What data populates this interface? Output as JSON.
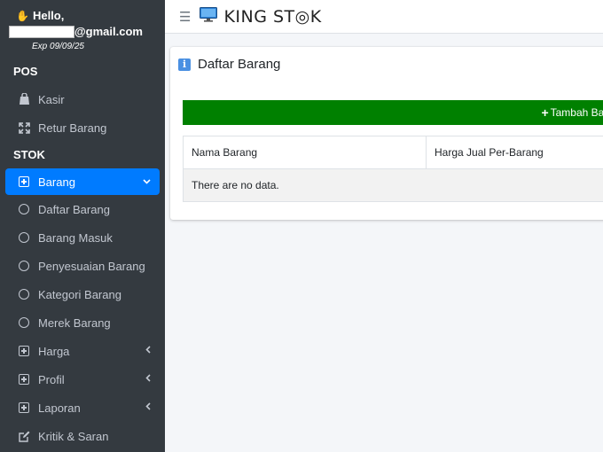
{
  "user": {
    "greeting": "Hello,",
    "email_suffix": "@gmail.com",
    "expiry": "Exp 09/09/25"
  },
  "sidebar": {
    "sections": {
      "pos": "POS",
      "stok": "STOK"
    },
    "pos_items": [
      {
        "label": "Kasir",
        "icon": "shopping-bag-icon"
      },
      {
        "label": "Retur Barang",
        "icon": "return-arrows-icon"
      }
    ],
    "stok_items": [
      {
        "label": "Barang",
        "icon": "plus-square-icon",
        "active": true,
        "chevron": "down"
      },
      {
        "label": "Daftar Barang",
        "icon": "circle-icon"
      },
      {
        "label": "Barang Masuk",
        "icon": "circle-icon"
      },
      {
        "label": "Penyesuaian Barang",
        "icon": "circle-icon"
      },
      {
        "label": "Kategori Barang",
        "icon": "circle-icon"
      },
      {
        "label": "Merek Barang",
        "icon": "circle-icon"
      },
      {
        "label": "Harga",
        "icon": "plus-square-icon",
        "chevron": "left"
      },
      {
        "label": "Profil",
        "icon": "plus-square-icon",
        "chevron": "left"
      },
      {
        "label": "Laporan",
        "icon": "plus-square-icon",
        "chevron": "left"
      },
      {
        "label": "Kritik & Saran",
        "icon": "edit-icon"
      }
    ]
  },
  "navbar": {
    "brand": "KING ST◎K",
    "menu_icon": "hamburger-icon"
  },
  "main": {
    "card_title": "Daftar Barang",
    "add_button": "Tambah Bara",
    "table": {
      "columns": [
        "Nama Barang",
        "Harga Jual Per-Barang"
      ],
      "empty_text": "There are no data."
    }
  },
  "colors": {
    "sidebar_bg": "#343a40",
    "active_item": "#007bff",
    "add_button": "#008000",
    "info_icon": "#4a90e2"
  }
}
